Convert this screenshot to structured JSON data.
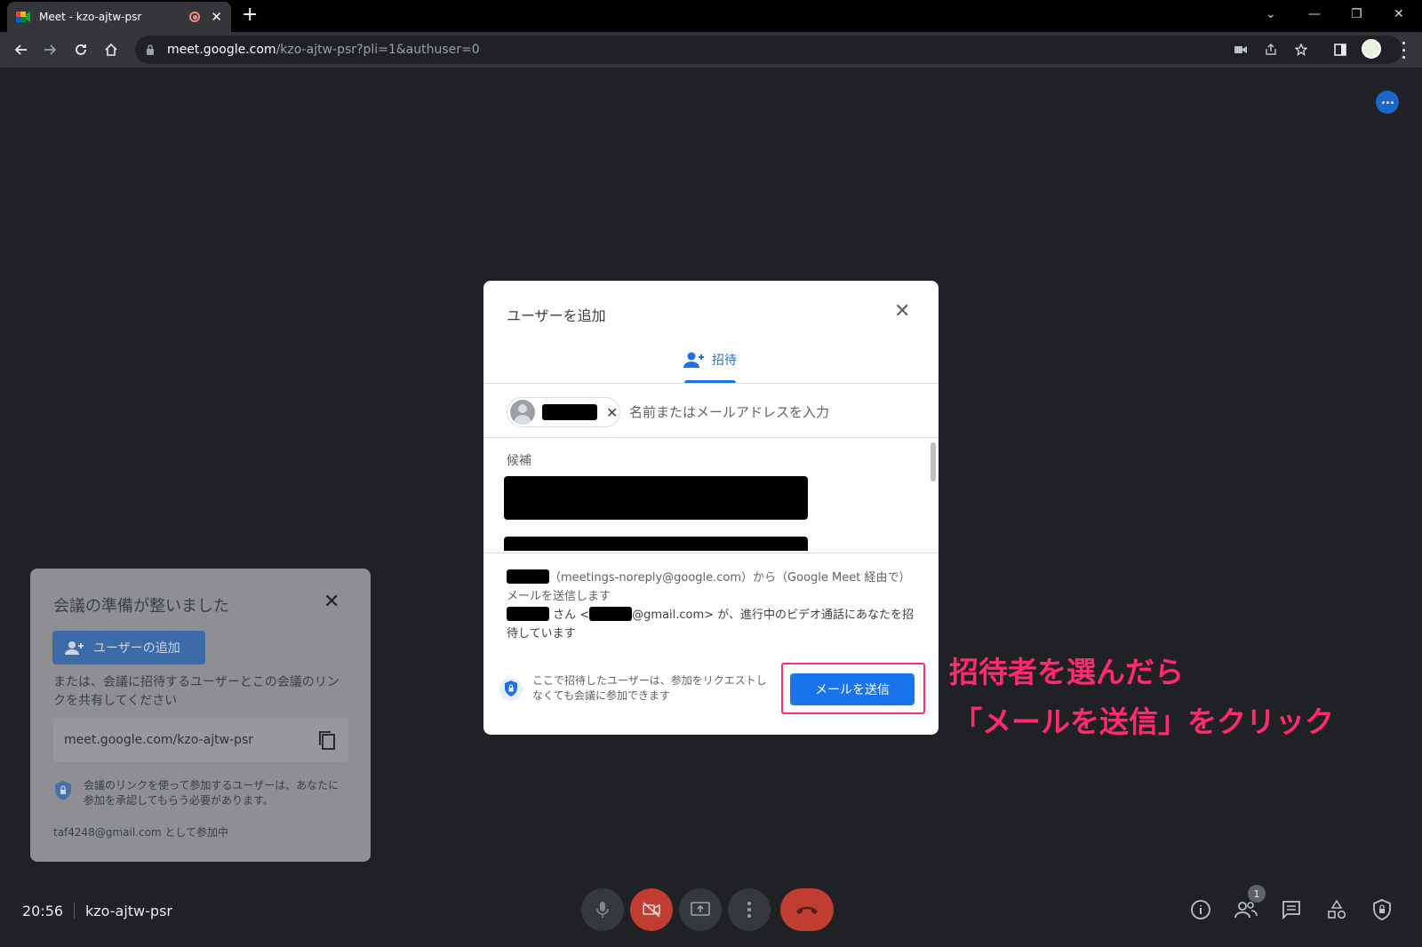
{
  "browser": {
    "tab_title": "Meet - kzo-ajtw-psr",
    "url_host": "meet.google.com",
    "url_path": "/kzo-ajtw-psr?pli=1&authuser=0"
  },
  "ready_panel": {
    "title": "会議の準備が整いました",
    "add_user_label": "ユーザーの追加",
    "share_text": "または、会議に招待するユーザーとこの会議のリンクを共有してください",
    "meeting_link": "meet.google.com/kzo-ajtw-psr",
    "note": "会議のリンクを使って参加するユーザーは、あなたに参加を承認してもらう必要があります。",
    "joined_as": "taf4248@gmail.com として参加中"
  },
  "modal": {
    "title": "ユーザーを追加",
    "tab_invite_label": "招待",
    "input_placeholder": "名前またはメールアドレスを入力",
    "suggestions_label": "候補",
    "message_line1": "（meetings-noreply@google.com）から（Google Meet 経由で）メールを送信します",
    "message_line2_a": "さん <",
    "message_line2_b": "@gmail.com> が、進行中のビデオ通話にあなたを招待しています",
    "privacy_note": "ここで招待したユーザーは、参加をリクエストしなくても会議に参加できます",
    "send_label": "メールを送信"
  },
  "annotation": {
    "line1": "招待者を選んだら",
    "line2": "「メールを送信」をクリック",
    "color": "#ff2a6d"
  },
  "bottom_bar": {
    "time": "20:56",
    "meeting_code": "kzo-ajtw-psr",
    "participants_count": "1"
  },
  "colors": {
    "accent": "#1a73e8",
    "danger": "#ea4335",
    "background": "#202124"
  }
}
